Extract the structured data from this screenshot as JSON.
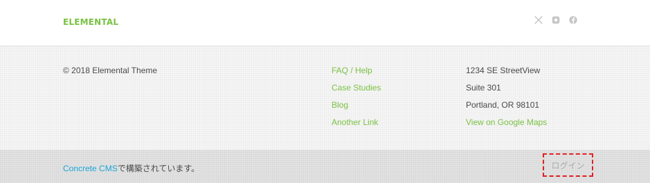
{
  "header": {
    "logo_text": "ELEMENTAL",
    "social_icons": [
      "x-icon",
      "instagram-icon",
      "facebook-icon"
    ]
  },
  "footer": {
    "copyright": "© 2018 Elemental Theme",
    "links": [
      "FAQ / Help",
      "Case Studies",
      "Blog",
      "Another Link"
    ],
    "address": {
      "line1": "1234 SE StreetView",
      "line2": "Suite 301",
      "line3": "Portland, OR 98101",
      "map_link": "View on Google Maps"
    }
  },
  "bottom": {
    "cms_link": "Concrete CMS",
    "credit_suffix": "で構築されています。",
    "login": "ログイン"
  },
  "colors": {
    "accent_green": "#7ac143",
    "link_blue": "#1ba5d6",
    "highlight_red": "#e02020"
  }
}
